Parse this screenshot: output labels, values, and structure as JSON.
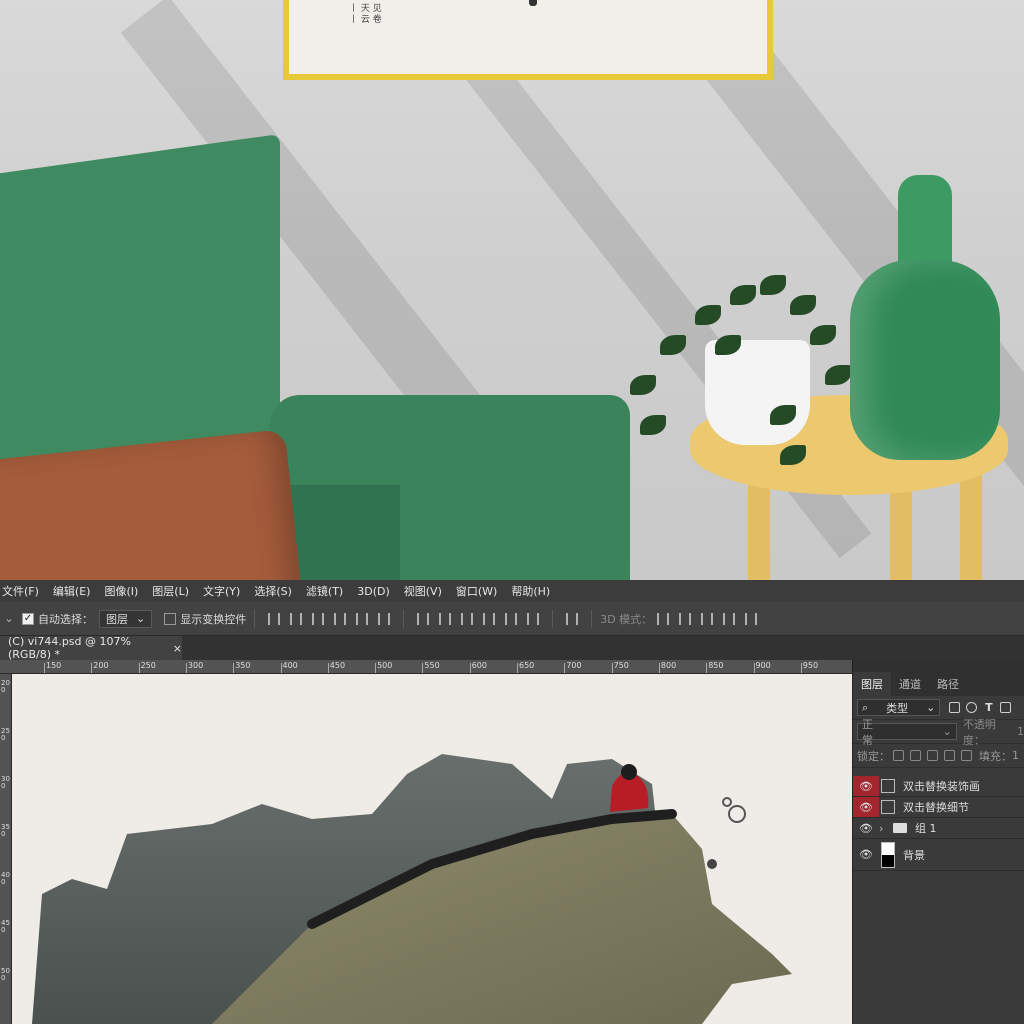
{
  "menubar": [
    "文件(F)",
    "编辑(E)",
    "图像(I)",
    "图层(L)",
    "文字(Y)",
    "选择(S)",
    "滤镜(T)",
    "3D(D)",
    "视图(V)",
    "窗口(W)",
    "帮助(H)"
  ],
  "options": {
    "auto_select_label": "自动选择：",
    "auto_select_value": "图层",
    "show_transform_label": "显示变换控件",
    "mode_3d_label": "3D 模式："
  },
  "document_tab": {
    "title": "(C) vi744.psd @ 107%(RGB/8) *",
    "close": "×"
  },
  "ruler": {
    "top": [
      "150",
      "200",
      "250",
      "300",
      "350",
      "400",
      "450",
      "500",
      "550",
      "600",
      "650",
      "700",
      "750",
      "800",
      "850",
      "900",
      "950"
    ],
    "left": [
      "200",
      "250",
      "300",
      "350",
      "400",
      "450",
      "500"
    ]
  },
  "layers_panel": {
    "tabs": [
      "图层",
      "通道",
      "路径"
    ],
    "filter_kind": "类型",
    "blend_mode": "正常",
    "opacity_label": "不透明度：",
    "opacity_value": "1",
    "lock_label": "锁定：",
    "fill_label": "填充：",
    "fill_value": "1",
    "layers": [
      {
        "name": "双击替换装饰画",
        "visible": true,
        "highlight": true
      },
      {
        "name": "双击替换细节",
        "visible": true,
        "highlight": true
      },
      {
        "name": "组 1",
        "visible": true,
        "highlight": false
      },
      {
        "name": "背景",
        "visible": true,
        "highlight": false
      }
    ]
  },
  "colors": {
    "ps_dark": "#2b2b2b",
    "ps_panel": "#3a3a3a",
    "eye_highlight": "#a1262d",
    "frame_gold": "#e8c937",
    "sofa_green": "#3f8a60"
  }
}
